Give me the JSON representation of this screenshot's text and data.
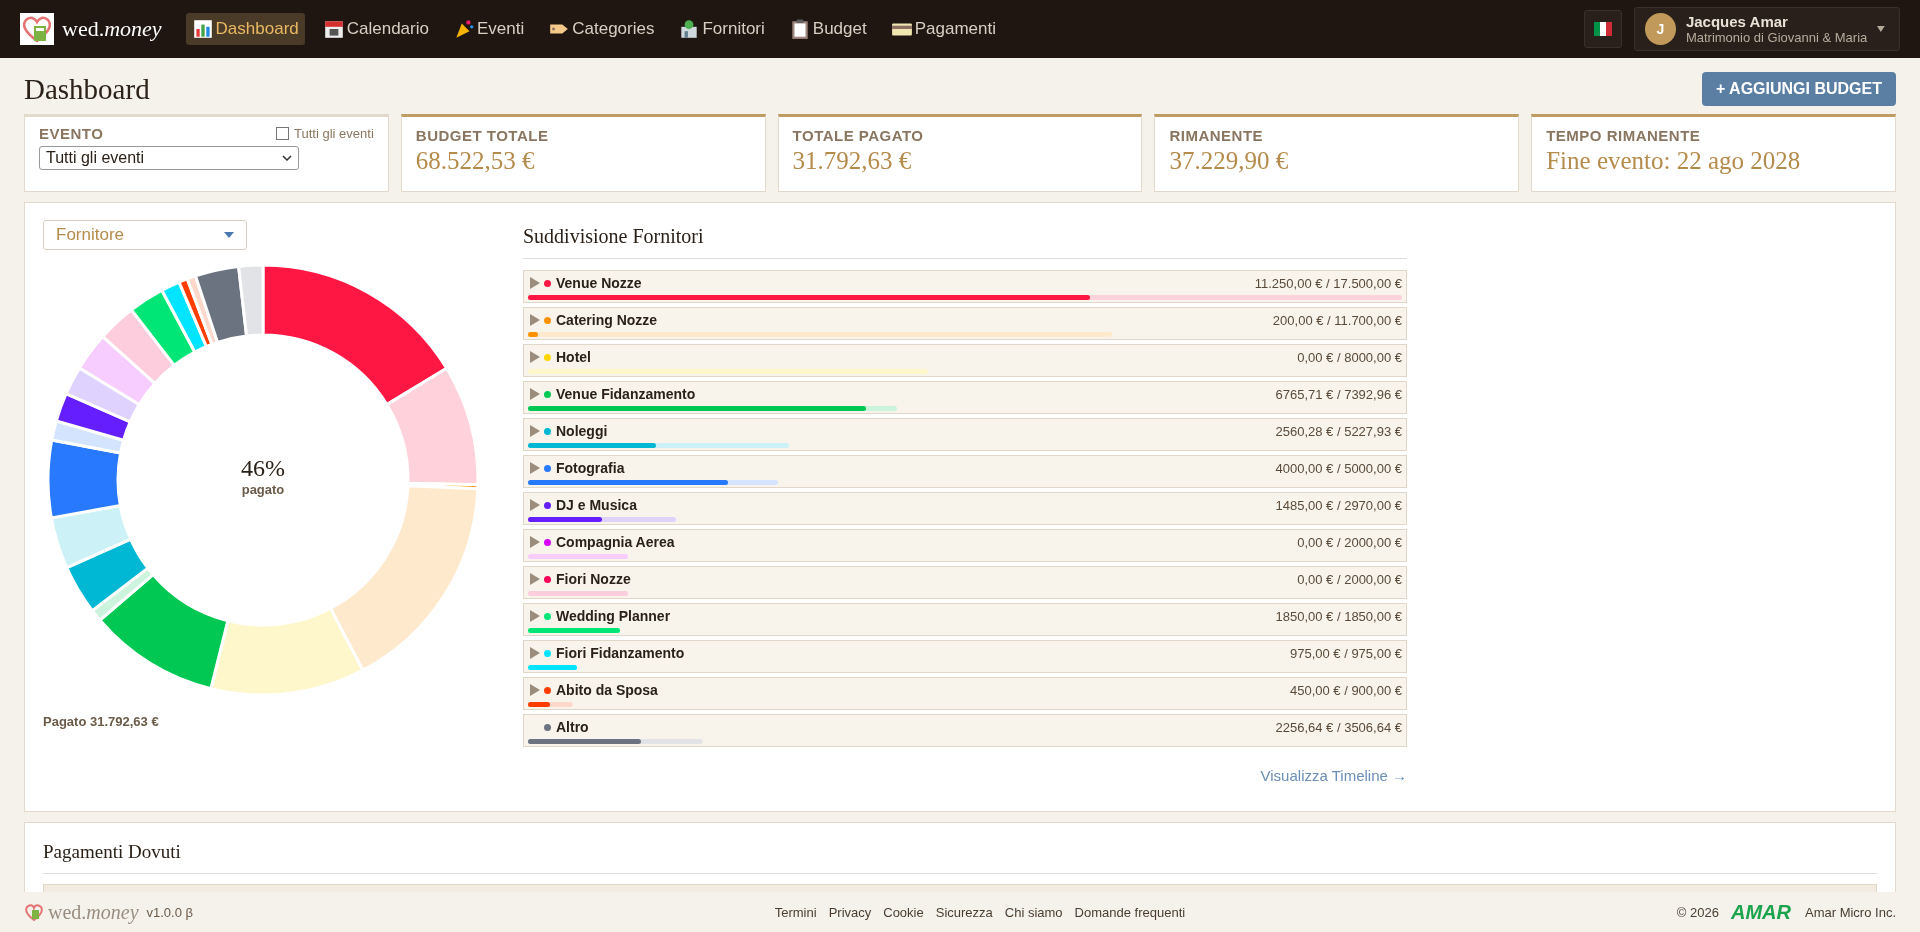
{
  "nav": {
    "brand": "wed.*money*",
    "items": [
      {
        "label": "Dashboard",
        "selected": true
      },
      {
        "label": "Calendario",
        "selected": false
      },
      {
        "label": "Eventi",
        "selected": false
      },
      {
        "label": "Categories",
        "selected": false
      },
      {
        "label": "Fornitori",
        "selected": false
      },
      {
        "label": "Budget",
        "selected": false
      },
      {
        "label": "Pagamenti",
        "selected": false
      }
    ],
    "user": {
      "initial": "J",
      "name": "Jacques Amar",
      "subtitle": "Matrimonio di Giovanni & Maria"
    }
  },
  "page_title": "Dashboard",
  "add_button": "+ AGGIUNGI BUDGET",
  "event_card": {
    "label": "EVENTO",
    "checkbox": {
      "label": "Tutti gli eventi",
      "checked": false
    },
    "select": "Tutti gli eventi"
  },
  "stats": [
    {
      "label": "BUDGET TOTALE",
      "value": "68.522,53 €"
    },
    {
      "label": "TOTALE PAGATO",
      "value": "31.792,63 €"
    },
    {
      "label": "RIMANENTE",
      "value": "37.229,90 €"
    },
    {
      "label": "TEMPO RIMANENTE",
      "value": "Fine evento: 22 ago 2028"
    }
  ],
  "breakdown": {
    "group_select": "Fornitore",
    "donut": {
      "percent": "46%",
      "caption": "pagato"
    },
    "paid_total": "Pagato 31.792,63 €",
    "title": "Suddivisione Fornitori",
    "rows": [
      {
        "name": "Venue Nozze",
        "amount": "11.250,00 € / 17.500,00 €",
        "color": "#ff1744",
        "level": 0.643,
        "expandable": true
      },
      {
        "name": "Catering Nozze",
        "amount": "200,00 € / 11.700,00 €",
        "color": "#ff9100",
        "level": 0.017,
        "expandable": true
      },
      {
        "name": "Hotel",
        "amount": "0,00 € / 8000,00 €",
        "color": "#ffd600",
        "level": 0,
        "expandable": true
      },
      {
        "name": "Venue Fidanzamento",
        "amount": "6765,71 € / 7392,96 €",
        "color": "#00c853",
        "level": 0.915,
        "expandable": true
      },
      {
        "name": "Noleggi",
        "amount": "2560,28 € / 5227,93 €",
        "color": "#00b8d4",
        "level": 0.49,
        "expandable": true
      },
      {
        "name": "Fotografia",
        "amount": "4000,00 € / 5000,00 €",
        "color": "#2979ff",
        "level": 0.8,
        "expandable": true
      },
      {
        "name": "DJ e Musica",
        "amount": "1485,00 € / 2970,00 €",
        "color": "#651fff",
        "level": 0.5,
        "expandable": true
      },
      {
        "name": "Compagnia Aerea",
        "amount": "0,00 € / 2000,00 €",
        "color": "#d500f9",
        "level": 0,
        "expandable": true
      },
      {
        "name": "Fiori Nozze",
        "amount": "0,00 € / 2000,00 €",
        "color": "#f50057",
        "level": 0,
        "expandable": true
      },
      {
        "name": "Wedding Planner",
        "amount": "1850,00 € / 1850,00 €",
        "color": "#00e676",
        "level": 1,
        "expandable": true
      },
      {
        "name": "Fiori Fidanzamento",
        "amount": "975,00 € / 975,00 €",
        "color": "#00e5ff",
        "level": 1,
        "expandable": true
      },
      {
        "name": "Abito da Sposa",
        "amount": "450,00 € / 900,00 €",
        "color": "#ff3d00",
        "level": 0.5,
        "expandable": true
      },
      {
        "name": "Altro",
        "amount": "2256,64 € / 3506,64 €",
        "color": "#6b7280",
        "level": 0.644,
        "expandable": false
      }
    ],
    "link": "Visualizza Timeline →"
  },
  "payments": {
    "title": "Pagamenti Dovuti"
  },
  "footer": {
    "brand": "wed.*money*",
    "version": "v1.0.0 β",
    "links": [
      "Termini",
      "Privacy",
      "Cookie",
      "Sicurezza",
      "Chi siamo",
      "Domande frequenti"
    ],
    "copyright": "© 2026",
    "company_logo": "AMAR",
    "company": "Amar Micro Inc."
  }
}
